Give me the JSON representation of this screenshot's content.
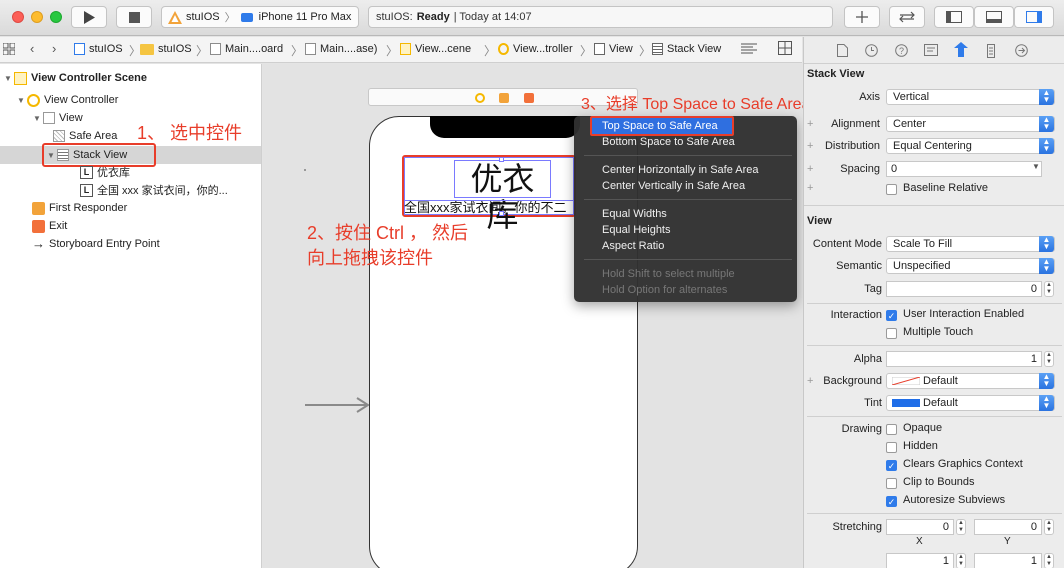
{
  "toolbar": {
    "scheme": "stuIOS",
    "device": "iPhone 11 Pro Max",
    "status_app": "stuIOS:",
    "status_state": "Ready",
    "status_time": "| Today at 14:07"
  },
  "jumpbar": {
    "crumbs": [
      "stuIOS",
      "stuIOS",
      "Main....oard",
      "Main....ase)",
      "View...cene",
      "View...troller",
      "View",
      "Stack View"
    ]
  },
  "navigator": {
    "items": [
      {
        "label": "View Controller Scene"
      },
      {
        "label": "View Controller"
      },
      {
        "label": "View"
      },
      {
        "label": "Safe Area"
      },
      {
        "label": "Stack View"
      },
      {
        "label": "优衣库"
      },
      {
        "label": "全国 xxx 家试衣间，你的..."
      },
      {
        "label": "First Responder"
      },
      {
        "label": "Exit"
      },
      {
        "label": "Storyboard Entry Point"
      }
    ]
  },
  "canvas": {
    "big_label": "优衣库",
    "sub_label": "全国xxx家试衣间，你的不二"
  },
  "context_menu": {
    "items": [
      {
        "label": "Top Space to Safe Area",
        "selected": true
      },
      {
        "label": "Bottom Space to Safe Area"
      },
      {
        "label": "Center Horizontally in Safe Area"
      },
      {
        "label": "Center Vertically in Safe Area"
      },
      {
        "label": "Equal Widths"
      },
      {
        "label": "Equal Heights"
      },
      {
        "label": "Aspect Ratio"
      },
      {
        "label": "Hold Shift to select multiple",
        "disabled": true
      },
      {
        "label": "Hold Option for alternates",
        "disabled": true
      }
    ]
  },
  "annotations": {
    "step1": "1、 选中控件",
    "step2_line1": "2、按住 Ctrl ， 然后",
    "step2_line2": "向上拖拽该控件",
    "step3": "3、选择 Top Space to Safe Area",
    "color": "#e83d2a"
  },
  "inspector": {
    "stack_title": "Stack View",
    "axis_label": "Axis",
    "axis_value": "Vertical",
    "alignment_label": "Alignment",
    "alignment_value": "Center",
    "distribution_label": "Distribution",
    "distribution_value": "Equal Centering",
    "spacing_label": "Spacing",
    "spacing_value": "0",
    "baseline_label": "Baseline Relative",
    "view_title": "View",
    "content_mode_label": "Content Mode",
    "content_mode_value": "Scale To Fill",
    "semantic_label": "Semantic",
    "semantic_value": "Unspecified",
    "tag_label": "Tag",
    "tag_value": "0",
    "interaction_label": "Interaction",
    "user_interaction": "User Interaction Enabled",
    "multiple_touch": "Multiple Touch",
    "alpha_label": "Alpha",
    "alpha_value": "1",
    "background_label": "Background",
    "background_value": "Default",
    "tint_label": "Tint",
    "tint_value": "Default",
    "drawing_label": "Drawing",
    "opaque": "Opaque",
    "hidden": "Hidden",
    "clears_graphics": "Clears Graphics Context",
    "clip_bounds": "Clip to Bounds",
    "autoresize": "Autoresize Subviews",
    "stretching_label": "Stretching",
    "stretch_x_value": "0",
    "stretch_y_value": "0",
    "x_label": "X",
    "y_label": "Y",
    "stretch_w_value": "1",
    "stretch_h_value": "1"
  }
}
